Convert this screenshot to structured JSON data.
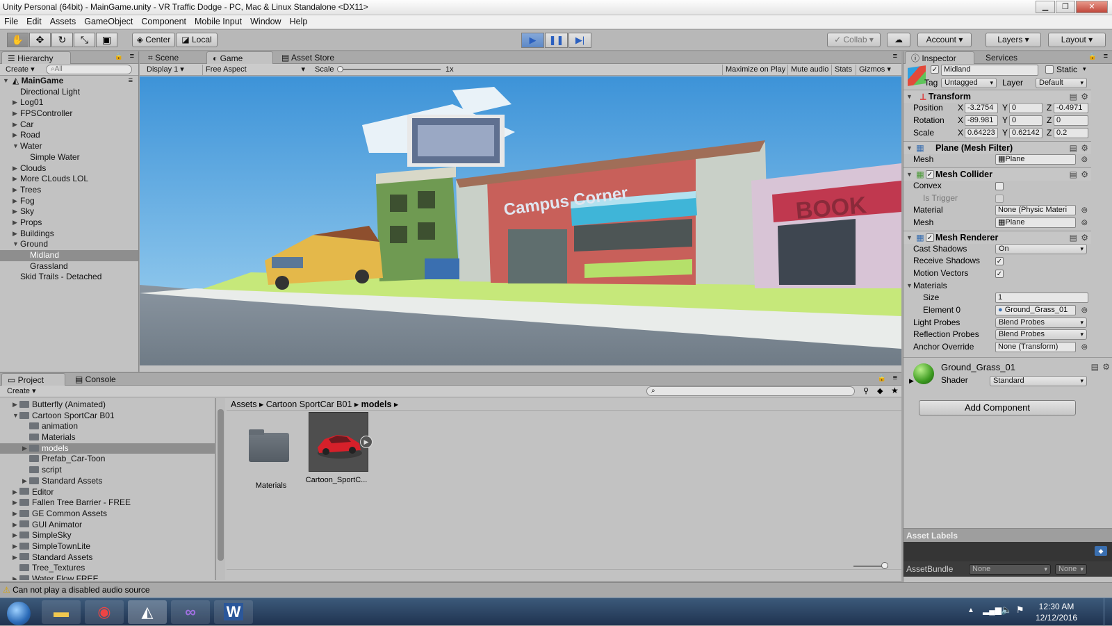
{
  "window": {
    "title": "Unity Personal (64bit) - MainGame.unity - VR Traffic Dodge - PC, Mac & Linux Standalone <DX11>"
  },
  "menu": [
    "File",
    "Edit",
    "Assets",
    "GameObject",
    "Component",
    "Mobile Input",
    "Window",
    "Help"
  ],
  "toolbar": {
    "center": "Center",
    "local": "Local",
    "collab": "Collab",
    "account": "Account",
    "layers": "Layers",
    "layout": "Layout"
  },
  "hierarchy": {
    "tab": "Hierarchy",
    "create": "Create",
    "search_placeholder": "All",
    "scene": "MainGame",
    "items": [
      {
        "label": "Directional Light",
        "depth": 1,
        "arrow": ""
      },
      {
        "label": "Log01",
        "depth": 1,
        "arrow": "right"
      },
      {
        "label": "FPSController",
        "depth": 1,
        "arrow": "right"
      },
      {
        "label": "Car",
        "depth": 1,
        "arrow": "right"
      },
      {
        "label": "Road",
        "depth": 1,
        "arrow": "right"
      },
      {
        "label": "Water",
        "depth": 1,
        "arrow": "down"
      },
      {
        "label": "Simple Water",
        "depth": 2,
        "arrow": ""
      },
      {
        "label": "Clouds",
        "depth": 1,
        "arrow": "right"
      },
      {
        "label": "More CLouds LOL",
        "depth": 1,
        "arrow": "right"
      },
      {
        "label": "Trees",
        "depth": 1,
        "arrow": "right"
      },
      {
        "label": "Fog",
        "depth": 1,
        "arrow": "right"
      },
      {
        "label": "Sky",
        "depth": 1,
        "arrow": "right"
      },
      {
        "label": "Props",
        "depth": 1,
        "arrow": "right"
      },
      {
        "label": "Buildings",
        "depth": 1,
        "arrow": "right"
      },
      {
        "label": "Ground",
        "depth": 1,
        "arrow": "down"
      },
      {
        "label": "Midland",
        "depth": 2,
        "arrow": "",
        "selected": true
      },
      {
        "label": "Grassland",
        "depth": 2,
        "arrow": ""
      },
      {
        "label": "Skid Trails - Detached",
        "depth": 1,
        "arrow": ""
      }
    ]
  },
  "game": {
    "tabs": [
      "Scene",
      "Game",
      "Asset Store"
    ],
    "display": "Display 1",
    "aspect": "Free Aspect",
    "scale_label": "Scale",
    "scale_value": "1x",
    "buttons": [
      "Maximize on Play",
      "Mute audio",
      "Stats",
      "Gizmos"
    ],
    "sign_text": "Campus Corner",
    "sign2_text": "BOOK"
  },
  "inspector": {
    "tabs": [
      "Inspector",
      "Services"
    ],
    "object_name": "Midland",
    "static_label": "Static",
    "tag_label": "Tag",
    "tag_value": "Untagged",
    "layer_label": "Layer",
    "layer_value": "Default",
    "transform": {
      "title": "Transform",
      "position": {
        "label": "Position",
        "x": "-3.2754",
        "y": "0",
        "z": "-0.4971"
      },
      "rotation": {
        "label": "Rotation",
        "x": "-89.981",
        "y": "0",
        "z": "0"
      },
      "scale": {
        "label": "Scale",
        "x": "0.64223",
        "y": "0.62142",
        "z": "0.2"
      }
    },
    "mesh_filter": {
      "title": "Plane (Mesh Filter)",
      "mesh_label": "Mesh",
      "mesh_value": "Plane"
    },
    "mesh_collider": {
      "title": "Mesh Collider",
      "convex": "Convex",
      "is_trigger": "Is Trigger",
      "material_label": "Material",
      "material_value": "None (Physic Materi",
      "mesh_label": "Mesh",
      "mesh_value": "Plane"
    },
    "mesh_renderer": {
      "title": "Mesh Renderer",
      "cast_shadows": "Cast Shadows",
      "cast_shadows_value": "On",
      "receive_shadows": "Receive Shadows",
      "motion_vectors": "Motion Vectors",
      "materials": "Materials",
      "size_label": "Size",
      "size_value": "1",
      "element0_label": "Element 0",
      "element0_value": "Ground_Grass_01",
      "light_probes": "Light Probes",
      "light_probes_value": "Blend Probes",
      "reflection_probes": "Reflection Probes",
      "reflection_probes_value": "Blend Probes",
      "anchor_override": "Anchor Override",
      "anchor_override_value": "None (Transform)"
    },
    "material": {
      "name": "Ground_Grass_01",
      "shader_label": "Shader",
      "shader_value": "Standard"
    },
    "add_component": "Add Component",
    "asset_labels": "Asset Labels",
    "asset_bundle": "AssetBundle",
    "asset_bundle_value": "None",
    "asset_bundle_variant": "None"
  },
  "project": {
    "tabs": [
      "Project",
      "Console"
    ],
    "create": "Create",
    "tree": [
      {
        "label": "Butterfly (Animated)",
        "depth": 1,
        "arrow": "right"
      },
      {
        "label": "Cartoon SportCar B01",
        "depth": 1,
        "arrow": "down"
      },
      {
        "label": "animation",
        "depth": 2,
        "arrow": ""
      },
      {
        "label": "Materials",
        "depth": 2,
        "arrow": ""
      },
      {
        "label": "models",
        "depth": 2,
        "arrow": "right",
        "selected": true
      },
      {
        "label": "Prefab_Car-Toon",
        "depth": 2,
        "arrow": ""
      },
      {
        "label": "script",
        "depth": 2,
        "arrow": ""
      },
      {
        "label": "Standard Assets",
        "depth": 2,
        "arrow": "right"
      },
      {
        "label": "Editor",
        "depth": 1,
        "arrow": "right"
      },
      {
        "label": "Fallen Tree Barrier - FREE",
        "depth": 1,
        "arrow": "right"
      },
      {
        "label": "GE Common Assets",
        "depth": 1,
        "arrow": "right"
      },
      {
        "label": "GUI Animator",
        "depth": 1,
        "arrow": "right"
      },
      {
        "label": "SimpleSky",
        "depth": 1,
        "arrow": "right"
      },
      {
        "label": "SimpleTownLite",
        "depth": 1,
        "arrow": "right"
      },
      {
        "label": "Standard Assets",
        "depth": 1,
        "arrow": "right"
      },
      {
        "label": "Tree_Textures",
        "depth": 1,
        "arrow": ""
      },
      {
        "label": "Water Flow FREE",
        "depth": 1,
        "arrow": "right"
      }
    ],
    "breadcrumb": [
      "Assets",
      "Cartoon SportCar B01",
      "models"
    ],
    "assets": [
      {
        "label": "Materials",
        "type": "folder"
      },
      {
        "label": "Cartoon_SportC...",
        "type": "model"
      }
    ]
  },
  "status": {
    "message": "Can not play a disabled audio source"
  },
  "taskbar": {
    "time": "12:30 AM",
    "date": "12/12/2016"
  }
}
